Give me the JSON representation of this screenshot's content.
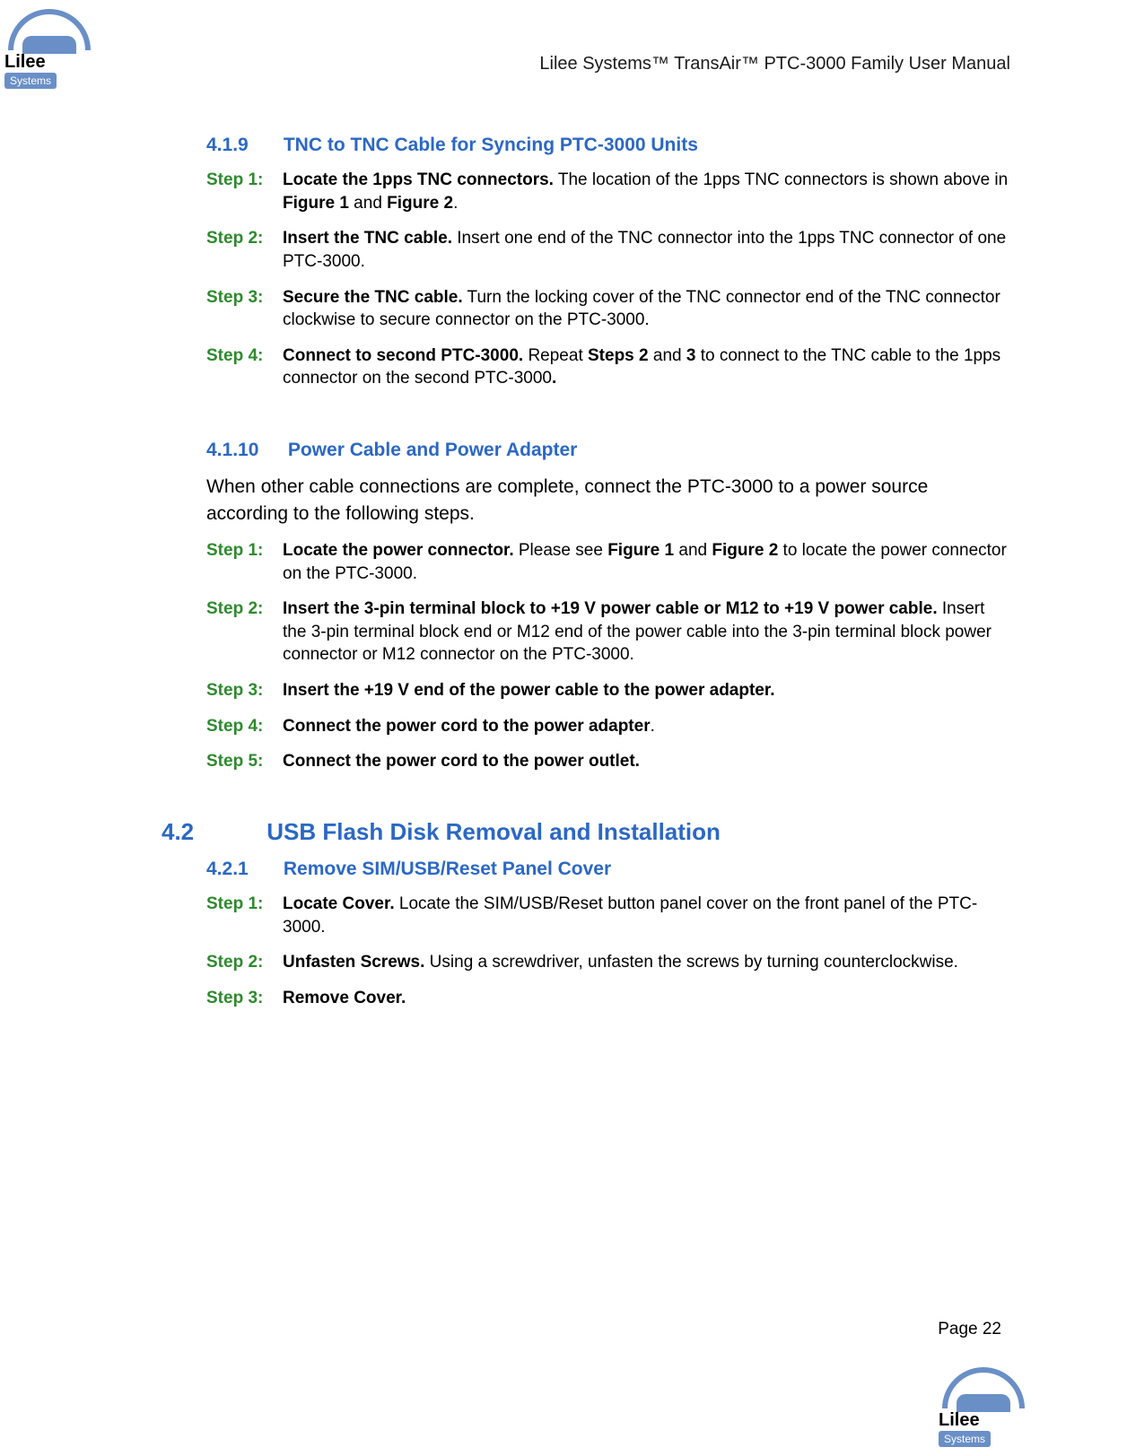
{
  "header": {
    "title": "Lilee Systems™ TransAir™ PTC-3000 Family User Manual"
  },
  "logo": {
    "name": "Lilee",
    "tag": "Systems"
  },
  "section_419": {
    "number": "4.1.9",
    "title": "TNC to TNC Cable for Syncing PTC-3000 Units",
    "steps": [
      {
        "label": "Step 1:",
        "bold": "Locate the 1pps TNC connectors.",
        "body_a": " The location of the 1pps TNC connectors is shown above in ",
        "ref1": "Figure 1",
        "mid": " and ",
        "ref2": "Figure 2",
        "tail": "."
      },
      {
        "label": "Step 2:",
        "bold": "Insert the TNC cable.",
        "body": " Insert one end of the TNC connector into the 1pps TNC connector of one PTC-3000."
      },
      {
        "label": "Step 3:",
        "bold": "Secure the TNC cable.",
        "body": " Turn the locking cover of the TNC connector end of the TNC connector clockwise to secure connector on the PTC-3000."
      },
      {
        "label": "Step 4:",
        "bold": "Connect to second PTC-3000.",
        "body_a": " Repeat ",
        "ref1": "Steps 2",
        "mid": " and ",
        "ref2": "3",
        "tail": " to connect to the TNC cable to the 1pps connector on the second PTC-3000",
        "dotbold": "."
      }
    ]
  },
  "section_4110": {
    "number": "4.1.10",
    "title": "Power Cable and Power Adapter",
    "intro": "When other cable connections are complete, connect the PTC-3000 to a power source according to the following steps.",
    "steps": [
      {
        "label": "Step 1:",
        "bold": "Locate the power connector.",
        "body_a": " Please see ",
        "ref1": "Figure 1",
        "mid": " and ",
        "ref2": "Figure 2",
        "tail": " to locate the power connector on the PTC-3000."
      },
      {
        "label": "Step 2:",
        "bold": "Insert the 3-pin terminal block to +19 V power cable or M12 to +19 V power cable.",
        "body": " Insert the 3-pin terminal block end or M12 end of the power cable into the 3-pin terminal block power connector or M12 connector on the PTC-3000."
      },
      {
        "label": "Step 3:",
        "bold": "Insert the +19 V end of the power cable to the power adapter."
      },
      {
        "label": "Step 4:",
        "bold": "Connect the power cord to the power adapter",
        "plain": "."
      },
      {
        "label": "Step 5:",
        "bold": "Connect the power cord to the power outlet."
      }
    ]
  },
  "section_42": {
    "number": "4.2",
    "title": "USB Flash Disk Removal and Installation"
  },
  "section_421": {
    "number": "4.2.1",
    "title": "Remove SIM/USB/Reset Panel Cover",
    "steps": [
      {
        "label": "Step 1:",
        "bold": "Locate Cover.",
        "body": " Locate the SIM/USB/Reset button panel cover on the front panel of the PTC-3000."
      },
      {
        "label": "Step 2:",
        "bold": "Unfasten Screws.",
        "body": " Using a screwdriver, unfasten the screws by turning counterclockwise."
      },
      {
        "label": "Step 3:",
        "bold": "Remove Cover."
      }
    ]
  },
  "footer": {
    "page": "Page 22"
  }
}
